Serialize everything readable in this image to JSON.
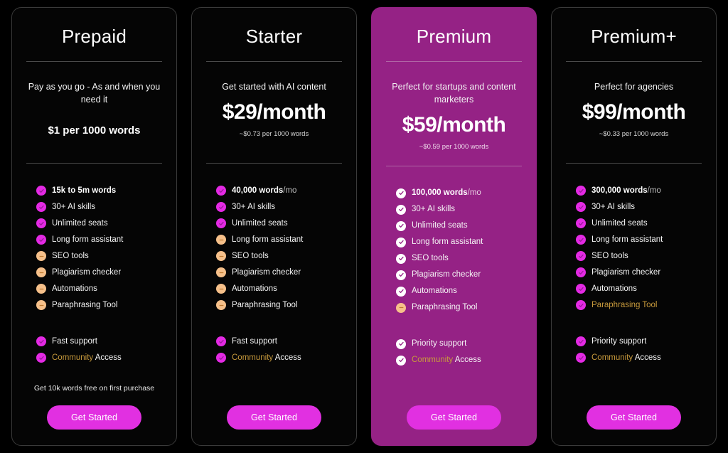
{
  "plans": [
    {
      "id": "prepaid",
      "name": "Prepaid",
      "featured": false,
      "tagline": "Pay as you go - As and when you need it",
      "price": "",
      "price_sub": "",
      "prepaid_price": "$1 per 1000 words",
      "features": [
        {
          "icon": "check-icon",
          "label": "15k to 5m words",
          "style": "bold"
        },
        {
          "icon": "check-icon",
          "label": "30+ AI skills",
          "style": "normal"
        },
        {
          "icon": "check-icon",
          "label": "Unlimited seats",
          "style": "normal"
        },
        {
          "icon": "check-icon",
          "label": "Long form assistant",
          "style": "normal"
        },
        {
          "icon": "minus-icon",
          "label": "SEO tools",
          "style": "normal"
        },
        {
          "icon": "minus-icon",
          "label": "Plagiarism checker",
          "style": "normal"
        },
        {
          "icon": "minus-icon",
          "label": "Automations",
          "style": "normal"
        },
        {
          "icon": "minus-icon",
          "label": "Paraphrasing Tool",
          "style": "normal"
        }
      ],
      "support": [
        {
          "icon": "check-icon",
          "label": "Fast support",
          "style": "normal"
        },
        {
          "icon": "check-icon",
          "label_gold": "Community",
          "label": " Access",
          "style": "split-gold"
        }
      ],
      "note": "Get 10k words free on first purchase",
      "cta_label": "Get Started"
    },
    {
      "id": "starter",
      "name": "Starter",
      "featured": false,
      "tagline": "Get started with AI content",
      "price": "$29/month",
      "price_sub": "~$0.73 per 1000 words",
      "prepaid_price": "",
      "features": [
        {
          "icon": "check-icon",
          "label_bold": "40,000 words",
          "label_muted": "/mo",
          "style": "split-muted"
        },
        {
          "icon": "check-icon",
          "label": "30+ AI skills",
          "style": "normal"
        },
        {
          "icon": "check-icon",
          "label": "Unlimited seats",
          "style": "normal"
        },
        {
          "icon": "minus-icon",
          "label": "Long form assistant",
          "style": "normal"
        },
        {
          "icon": "minus-icon",
          "label": "SEO tools",
          "style": "normal"
        },
        {
          "icon": "minus-icon",
          "label": "Plagiarism checker",
          "style": "normal"
        },
        {
          "icon": "minus-icon",
          "label": "Automations",
          "style": "normal"
        },
        {
          "icon": "minus-icon",
          "label": "Paraphrasing Tool",
          "style": "normal"
        }
      ],
      "support": [
        {
          "icon": "check-icon",
          "label": "Fast support",
          "style": "normal"
        },
        {
          "icon": "check-icon",
          "label_gold": "Community",
          "label": " Access",
          "style": "split-gold"
        }
      ],
      "note": "",
      "cta_label": "Get Started"
    },
    {
      "id": "premium",
      "name": "Premium",
      "featured": true,
      "tagline": "Perfect for startups and content marketers",
      "price": "$59/month",
      "price_sub": "~$0.59 per 1000 words",
      "prepaid_price": "",
      "features": [
        {
          "icon": "check-icon",
          "label_bold": "100,000 words",
          "label_muted": "/mo",
          "style": "split-muted"
        },
        {
          "icon": "check-icon",
          "label": "30+ AI skills",
          "style": "normal"
        },
        {
          "icon": "check-icon",
          "label": "Unlimited seats",
          "style": "normal"
        },
        {
          "icon": "check-icon",
          "label": "Long form assistant",
          "style": "normal"
        },
        {
          "icon": "check-icon",
          "label": "SEO tools",
          "style": "normal"
        },
        {
          "icon": "check-icon",
          "label": "Plagiarism checker",
          "style": "normal"
        },
        {
          "icon": "check-icon",
          "label": "Automations",
          "style": "normal"
        },
        {
          "icon": "minus-icon",
          "label": "Paraphrasing Tool",
          "style": "normal"
        }
      ],
      "support": [
        {
          "icon": "check-icon",
          "label": "Priority support",
          "style": "normal"
        },
        {
          "icon": "check-icon",
          "label_gold": "Community",
          "label": " Access",
          "style": "split-gold"
        }
      ],
      "note": "",
      "cta_label": "Get Started"
    },
    {
      "id": "premium-plus",
      "name": "Premium+",
      "featured": false,
      "tagline": "Perfect for agencies",
      "price": "$99/month",
      "price_sub": "~$0.33 per 1000 words",
      "prepaid_price": "",
      "features": [
        {
          "icon": "check-icon",
          "label_bold": "300,000 words",
          "label_muted": "/mo",
          "style": "split-muted"
        },
        {
          "icon": "check-icon",
          "label": "30+ AI skills",
          "style": "normal"
        },
        {
          "icon": "check-icon",
          "label": "Unlimited seats",
          "style": "normal"
        },
        {
          "icon": "check-icon",
          "label": "Long form assistant",
          "style": "normal"
        },
        {
          "icon": "check-icon",
          "label": "SEO tools",
          "style": "normal"
        },
        {
          "icon": "check-icon",
          "label": "Plagiarism checker",
          "style": "normal"
        },
        {
          "icon": "check-icon",
          "label": "Automations",
          "style": "normal"
        },
        {
          "icon": "check-icon",
          "label_gold_full": "Paraphrasing Tool",
          "style": "gold"
        }
      ],
      "support": [
        {
          "icon": "check-icon",
          "label": "Priority support",
          "style": "normal"
        },
        {
          "icon": "check-icon",
          "label_gold": "Community",
          "label": " Access",
          "style": "split-gold"
        }
      ],
      "note": "",
      "cta_label": "Get Started"
    }
  ],
  "colors": {
    "page_background": "#000000",
    "card_background": "#050505",
    "card_border": "#3a3a3a",
    "featured_background": "#952285",
    "cta_background": "#e130e1",
    "check_badge": "#e42ae4",
    "minus_badge": "#f6c08a",
    "gold_text": "#c89a3c"
  }
}
